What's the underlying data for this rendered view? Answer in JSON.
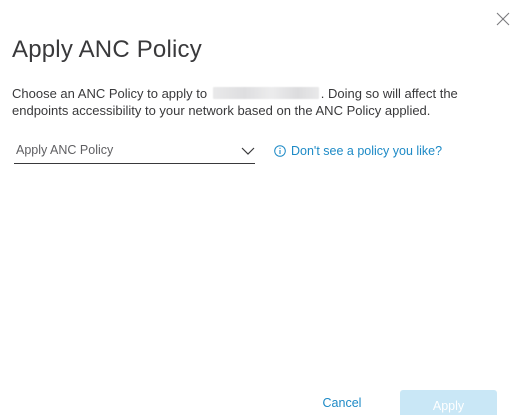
{
  "dialog": {
    "title": "Apply ANC Policy",
    "description_before": "Choose an ANC Policy to apply to ",
    "description_after": ". Doing so will affect the endpoints accessibility to your network based on the ANC Policy applied.",
    "policy_select": {
      "placeholder": "Apply ANC Policy"
    },
    "help_link": "Don't see a policy you like?",
    "cancel_label": "Cancel",
    "apply_label": "Apply"
  },
  "colors": {
    "text": "#39393b",
    "link": "#1d8ac6",
    "apply_disabled_bg": "#c9e7f6"
  },
  "icons": {
    "close": "close-icon",
    "chevron": "chevron-down-icon",
    "info": "info-icon"
  }
}
